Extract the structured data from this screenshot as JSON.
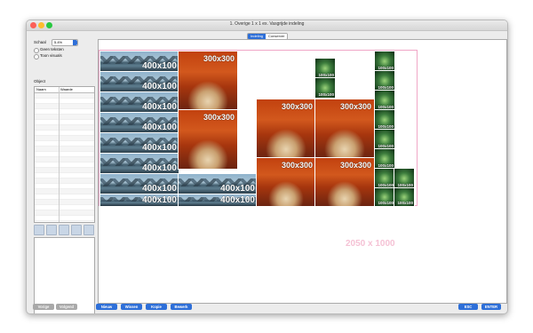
{
  "window": {
    "title": "1. Overige 1 x 1 ex. Vasgrijde indeling",
    "tabs": [
      {
        "label": "Indeling"
      },
      {
        "label": "Conserver"
      }
    ]
  },
  "left_panel": {
    "scale_label": "Schaal",
    "scale_value": "5.4%",
    "option_hide_texts": "Geen teksten",
    "option_show_visuals": "Toon visuals",
    "object_label": "Object",
    "table_headers": {
      "name": "Naam",
      "value": "Waarde"
    }
  },
  "canvas": {
    "size_label": "2050 x 1000",
    "landscape_label": "400x100",
    "autumn_label": "300x300",
    "forest_label": "100x100"
  },
  "bottom": {
    "prev": "Vorige",
    "next": "Volgend",
    "new": "Nieuw",
    "delete": "Wissen",
    "copy": "Kopie",
    "edit": "Bewerk",
    "esc": "ESC",
    "enter": "ENTER"
  },
  "colors": {
    "accent": "#2e6fd8",
    "area_border": "#f0a6c6",
    "area_label": "#f5c2d5",
    "traffic_close": "#fc5f57",
    "traffic_min": "#fdbc2e",
    "traffic_max": "#28c840"
  }
}
